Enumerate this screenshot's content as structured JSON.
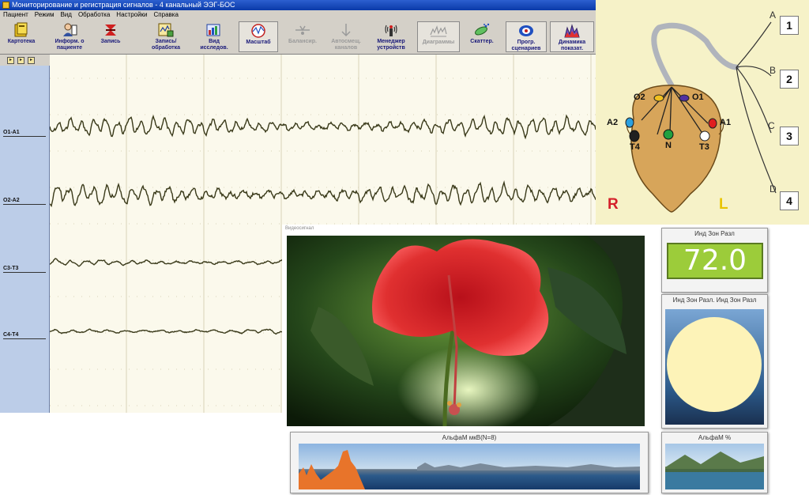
{
  "window": {
    "title": "Мониторирование и регистрация сигналов - 4 канальный ЭЭГ-БОС"
  },
  "menu": [
    "Пациент",
    "Режим",
    "Вид",
    "Обработка",
    "Настройки",
    "Справка"
  ],
  "toolbar": {
    "buttons": [
      {
        "label": "Картотека",
        "icon": "card-file-icon"
      },
      {
        "label": "Информ. о пациенте",
        "icon": "patient-info-icon"
      },
      {
        "label": "Запись",
        "icon": "record-icon"
      },
      {
        "label": "Запись/ обработка",
        "icon": "record-processing-icon"
      },
      {
        "label": "Вид исследов.",
        "icon": "study-view-icon"
      },
      {
        "label": "Масштаб",
        "icon": "scale-icon"
      },
      {
        "label": "Балансир.",
        "icon": "balance-icon"
      },
      {
        "label": "Автосмещ. каналов",
        "icon": "auto-offset-icon"
      },
      {
        "label": "Менеджер устройств",
        "icon": "device-manager-icon"
      },
      {
        "label": "Диаграммы",
        "icon": "diagrams-icon"
      },
      {
        "label": "Скаттер.",
        "icon": "scatter-icon"
      },
      {
        "label": "Прогр. сценариев",
        "icon": "scenario-program-icon"
      },
      {
        "label": "Динамика показат.",
        "icon": "dynamics-icon"
      }
    ]
  },
  "channels": [
    "O1-A1",
    "O2-A2",
    "C3-T3",
    "C4-T4"
  ],
  "electrodes": {
    "labels": [
      "O2",
      "O1",
      "A2",
      "A1",
      "T4",
      "N",
      "T3"
    ],
    "colors": {
      "O2": "#f0c020",
      "O1": "#5030a0",
      "A2": "#2aa0e0",
      "A1": "#e02020",
      "T4": "#202020",
      "N": "#20a040",
      "T3": "#ffffff"
    },
    "leads": [
      "A",
      "B",
      "C",
      "D"
    ],
    "channel_numbers": [
      "1",
      "2",
      "3",
      "4"
    ],
    "right_hemisphere": "R",
    "left_hemisphere": "L"
  },
  "feedback": {
    "window_title": "Видеосигнал",
    "index_caption": "Инд Зон Разл",
    "index_value": "72.0",
    "index2_caption": "Инд Зон Разл. Инд Зон Разл",
    "alpha_caption": "АльфаМ мкВ(N=8)",
    "alpha_small_caption": "АльфаМ %",
    "circle_fill": "#fdf3b8",
    "accent_green": "#9ccc3a",
    "bar_color": "#e8742a"
  }
}
